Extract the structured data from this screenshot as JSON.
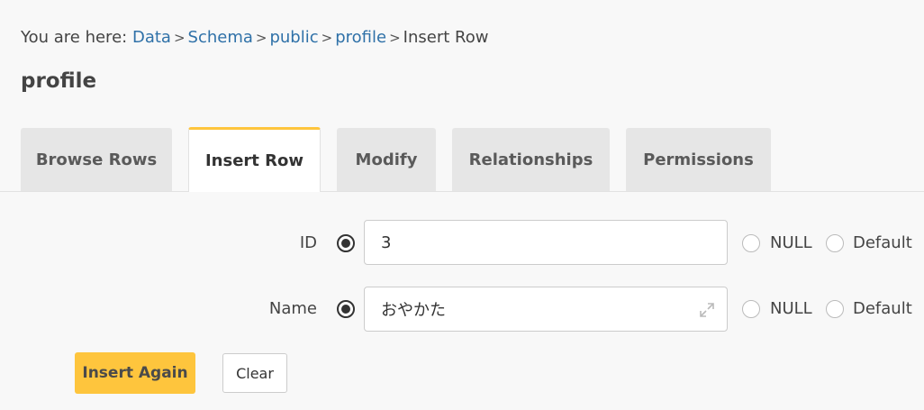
{
  "breadcrumb": {
    "prefix": "You are here:",
    "links": [
      "Data",
      "Schema",
      "public",
      "profile"
    ],
    "current": "Insert Row",
    "separator": ">"
  },
  "page": {
    "title": "profile"
  },
  "tabs": [
    {
      "label": "Browse Rows",
      "active": false
    },
    {
      "label": "Insert Row",
      "active": true
    },
    {
      "label": "Modify",
      "active": false
    },
    {
      "label": "Relationships",
      "active": false
    },
    {
      "label": "Permissions",
      "active": false
    }
  ],
  "form": {
    "fields": [
      {
        "label": "ID",
        "value": "3",
        "selected_option": "value",
        "null_label": "NULL",
        "default_label": "Default"
      },
      {
        "label": "Name",
        "value": "おやかた",
        "selected_option": "value",
        "null_label": "NULL",
        "default_label": "Default",
        "expand_icon": "expand-icon"
      }
    ]
  },
  "buttons": {
    "insert_again": "Insert Again",
    "clear": "Clear"
  },
  "colors": {
    "accent": "#fec53d",
    "link": "#2f71a8",
    "background": "#f8f8f8"
  }
}
